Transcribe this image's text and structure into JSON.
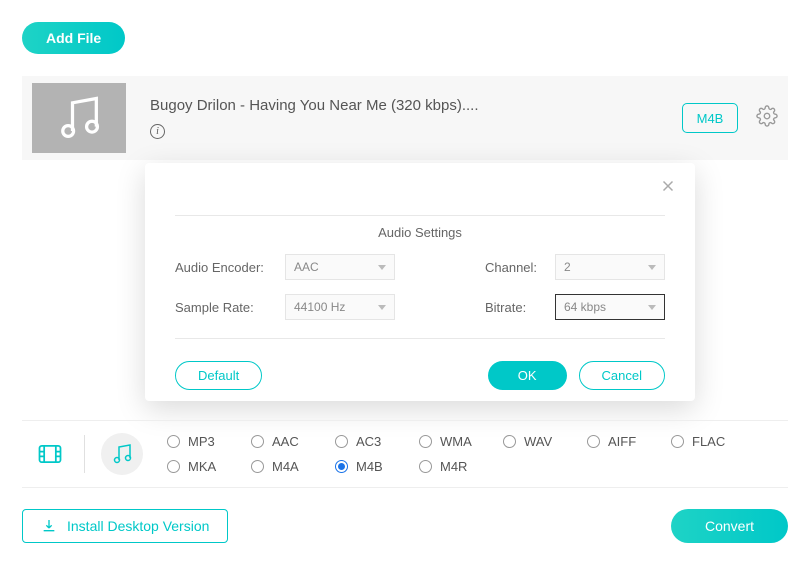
{
  "header": {
    "add_file": "Add File"
  },
  "file": {
    "title": "Bugoy Drilon - Having You Near Me (320 kbps)....",
    "format_badge": "M4B"
  },
  "modal": {
    "title": "Audio Settings",
    "labels": {
      "encoder": "Audio Encoder:",
      "sample_rate": "Sample Rate:",
      "channel": "Channel:",
      "bitrate": "Bitrate:"
    },
    "values": {
      "encoder": "AAC",
      "sample_rate": "44100 Hz",
      "channel": "2",
      "bitrate": "64 kbps"
    },
    "buttons": {
      "default": "Default",
      "ok": "OK",
      "cancel": "Cancel"
    }
  },
  "formats": {
    "row1": [
      "MP3",
      "AAC",
      "AC3",
      "WMA",
      "WAV",
      "AIFF",
      "FLAC"
    ],
    "row2": [
      "MKA",
      "M4A",
      "M4B",
      "M4R"
    ],
    "selected": "M4B"
  },
  "bottom": {
    "install": "Install Desktop Version",
    "convert": "Convert"
  }
}
